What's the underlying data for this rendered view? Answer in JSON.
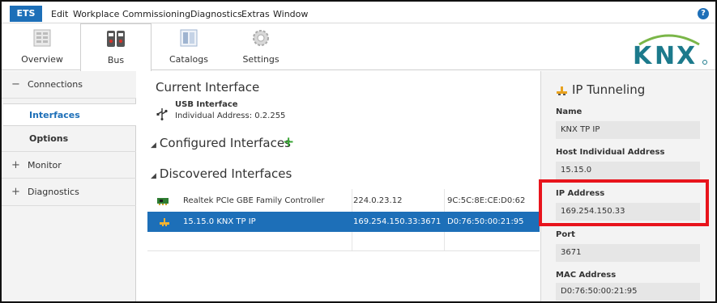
{
  "menubar": {
    "app_tab": "ETS",
    "items": [
      "Edit",
      "Workplace",
      "Commissioning",
      "Diagnostics",
      "Extras",
      "Window"
    ],
    "help": "?"
  },
  "ribbon": {
    "overview": "Overview",
    "bus": "Bus",
    "catalogs": "Catalogs",
    "settings": "Settings",
    "logo": "KNX"
  },
  "nav": {
    "connections": "Connections",
    "interfaces": "Interfaces",
    "options": "Options",
    "monitor": "Monitor",
    "diagnostics": "Diagnostics",
    "minus": "−",
    "plus": "+"
  },
  "main": {
    "current_title": "Current Interface",
    "usb_name": "USB Interface",
    "usb_address": "Individual Address: 0.2.255",
    "configured_title": "Configured Interfaces",
    "discovered_title": "Discovered Interfaces",
    "rows": [
      {
        "name": "Realtek PCIe GBE Family Controller",
        "ip": "224.0.23.12",
        "mac": "9C:5C:8E:CE:D0:62",
        "selected": false
      },
      {
        "name": "15.15.0  KNX TP IP",
        "ip": "169.254.150.33:3671",
        "mac": "D0:76:50:00:21:95",
        "selected": true
      }
    ]
  },
  "panel": {
    "title": "IP Tunneling",
    "name_label": "Name",
    "name_value": "KNX TP IP",
    "host_label": "Host Individual Address",
    "host_value": "15.15.0",
    "ip_label": "IP Address",
    "ip_value": "169.254.150.33",
    "port_label": "Port",
    "port_value": "3671",
    "mac_label": "MAC Address",
    "mac_value": "D0:76:50:00:21:95"
  },
  "colors": {
    "accent": "#1d6fb8",
    "highlight": "#e8141c",
    "add": "#3aa635"
  }
}
